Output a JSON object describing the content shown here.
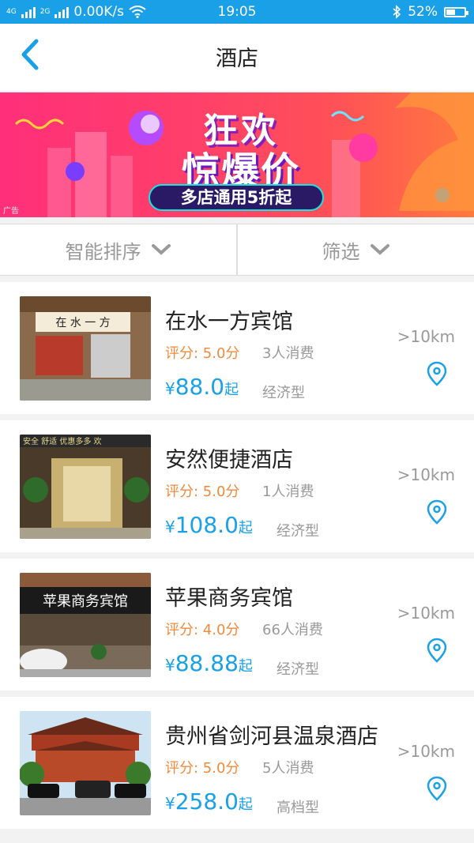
{
  "status": {
    "net": "4G",
    "net2": "2G",
    "speed": "0.00K/s",
    "time": "19:05",
    "battery": "52%",
    "battery_level": 0.52
  },
  "nav": {
    "title": "酒店"
  },
  "banner": {
    "line1": "狂欢",
    "line2": "惊爆价",
    "pill": "多店通用5折起",
    "ad": "广告"
  },
  "filters": {
    "sort": "智能排序",
    "filter": "筛选"
  },
  "hotels": [
    {
      "name": "在水一方宾馆",
      "score": "评分: 5.0分",
      "count": "3人消费",
      "currency": "¥",
      "price": "88.0",
      "suffix": "起",
      "type": "经济型",
      "distance": ">10km"
    },
    {
      "name": "安然便捷酒店",
      "score": "评分: 5.0分",
      "count": "1人消费",
      "currency": "¥",
      "price": "108.0",
      "suffix": "起",
      "type": "经济型",
      "distance": ">10km"
    },
    {
      "name": "苹果商务宾馆",
      "score": "评分: 4.0分",
      "count": "66人消费",
      "currency": "¥",
      "price": "88.88",
      "suffix": "起",
      "type": "经济型",
      "distance": ">10km"
    },
    {
      "name": "贵州省剑河县温泉酒店",
      "score": "评分: 5.0分",
      "count": "5人消费",
      "currency": "¥",
      "price": "258.0",
      "suffix": "起",
      "type": "高档型",
      "distance": ">10km"
    }
  ],
  "signs": {
    "h1": "在 水 一 方",
    "h2": "安全 舒适 优惠多多 欢",
    "h3": "苹果商务宾馆"
  },
  "colors": {
    "accent": "#1aa0e6",
    "score": "#f08a3c"
  }
}
